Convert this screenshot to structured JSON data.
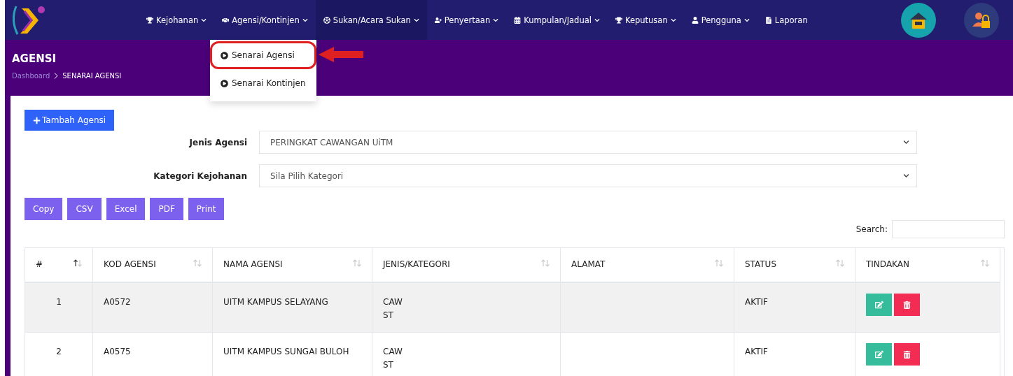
{
  "navbar": {
    "items": [
      {
        "label": "Kejohanan",
        "dropdown": true,
        "selected": false
      },
      {
        "label": "Agensi/Kontinjen",
        "dropdown": true,
        "selected": false
      },
      {
        "label": "Sukan/Acara Sukan",
        "dropdown": true,
        "selected": true
      },
      {
        "label": "Penyertaan",
        "dropdown": true,
        "selected": false
      },
      {
        "label": "Kumpulan/Jadual",
        "dropdown": true,
        "selected": false
      },
      {
        "label": "Keputusan",
        "dropdown": true,
        "selected": false
      },
      {
        "label": "Pengguna",
        "dropdown": true,
        "selected": false
      },
      {
        "label": "Laporan",
        "dropdown": false,
        "selected": false
      }
    ],
    "dropdown_menu": [
      {
        "label": "Senarai Agensi",
        "highlighted": true
      },
      {
        "label": "Senarai Kontinjen",
        "highlighted": false
      }
    ]
  },
  "header": {
    "title": "AGENSI",
    "breadcrumb": [
      "Dashboard",
      "SENARAI AGENSI"
    ]
  },
  "add_button": "Tambah Agensi",
  "filters": [
    {
      "label": "Jenis Agensi",
      "value": "PERINGKAT CAWANGAN UiTM"
    },
    {
      "label": "Kategori Kejohanan",
      "value": "Sila Pilih Kategori"
    }
  ],
  "export_buttons": [
    "Copy",
    "CSV",
    "Excel",
    "PDF",
    "Print"
  ],
  "search": {
    "label": "Search:"
  },
  "table": {
    "columns": [
      {
        "label": "#",
        "sorted": true
      },
      {
        "label": "KOD AGENSI",
        "sorted": false
      },
      {
        "label": "NAMA AGENSI",
        "sorted": false
      },
      {
        "label": "JENIS/KATEGORI",
        "sorted": false
      },
      {
        "label": "ALAMAT",
        "sorted": false
      },
      {
        "label": "STATUS",
        "sorted": false
      },
      {
        "label": "TINDAKAN",
        "sorted": false
      }
    ],
    "rows": [
      {
        "no": "1",
        "kod": "A0572",
        "nama": "UITM KAMPUS SELAYANG",
        "jenis": [
          "CAW",
          "ST"
        ],
        "status": "AKTIF"
      },
      {
        "no": "2",
        "kod": "A0575",
        "nama": "UITM KAMPUS SUNGAI BULOH",
        "jenis": [
          "CAW",
          "ST"
        ],
        "status": "AKTIF"
      }
    ]
  }
}
